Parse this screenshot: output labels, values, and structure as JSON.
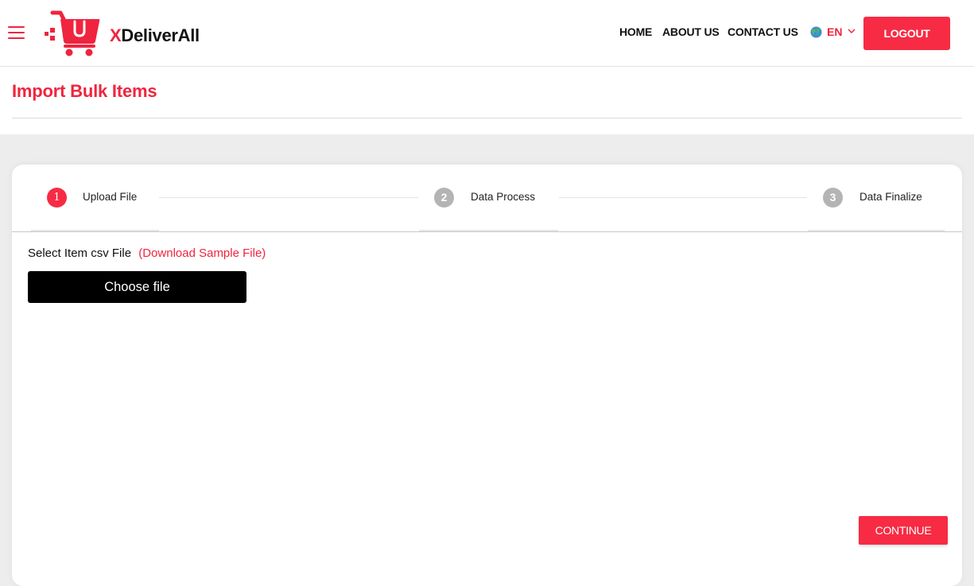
{
  "header": {
    "brand_prefix": "X",
    "brand_name": "DeliverAll",
    "nav": [
      {
        "label": "HOME"
      },
      {
        "label": "ABOUT US"
      },
      {
        "label": "CONTACT US"
      }
    ],
    "language": {
      "code": "EN",
      "icon": "globe-icon"
    },
    "logout_label": "LOGOUT"
  },
  "page": {
    "title": "Import Bulk Items"
  },
  "stepper": {
    "steps": [
      {
        "number": "1",
        "label": "Upload File",
        "state": "active"
      },
      {
        "number": "2",
        "label": "Data Process",
        "state": "inactive"
      },
      {
        "number": "3",
        "label": "Data Finalize",
        "state": "inactive"
      }
    ]
  },
  "upload": {
    "field_label": "Select Item csv File",
    "sample_link": "(Download Sample File)",
    "choose_file_label": "Choose file"
  },
  "footer": {
    "continue_label": "CONTINUE"
  },
  "colors": {
    "accent": "#f72b44",
    "inactive_step": "#b4b4b4"
  }
}
